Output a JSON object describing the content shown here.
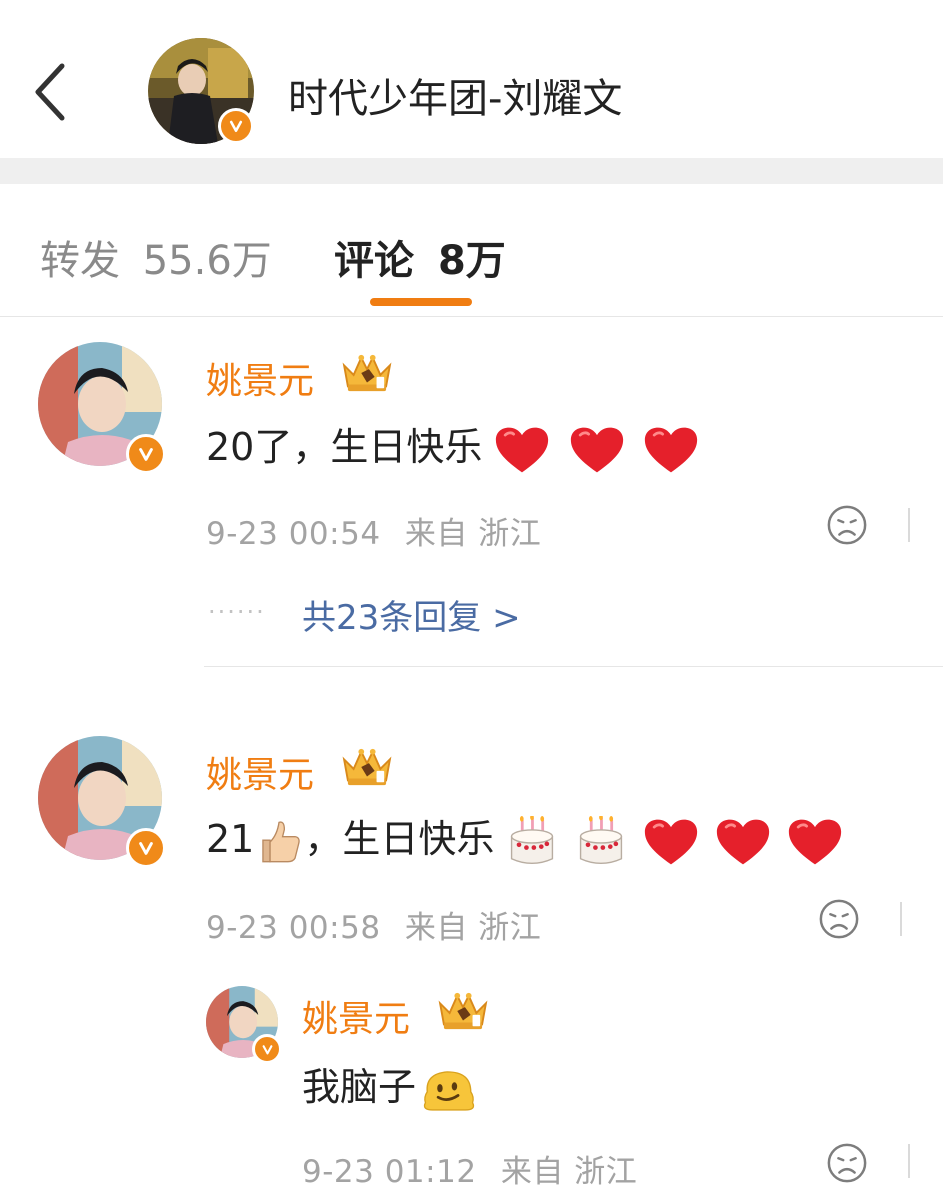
{
  "header": {
    "title": "时代少年团-刘耀文",
    "back_icon": "chevron-left-icon",
    "verified_icon": "verified-v-icon"
  },
  "tabs": [
    {
      "label": "转发",
      "count": "55.6万",
      "active": false
    },
    {
      "label": "评论",
      "count": "8万",
      "active": true
    }
  ],
  "colors": {
    "accent": "#f07d12",
    "link": "#4a6ba3",
    "meta": "#a3a3a3",
    "badge": "#f08a19"
  },
  "comments": [
    {
      "username": "姚景元",
      "badge_icon": "crown-badge-icon",
      "text": "20了，生日快乐",
      "emojis": [
        "heart-icon",
        "heart-icon",
        "heart-icon"
      ],
      "time": "9-23 00:54",
      "source": "来自 浙江",
      "reply_dots": "······",
      "reply_link": "共23条回复 >"
    },
    {
      "username": "姚景元",
      "badge_icon": "crown-badge-icon",
      "text_prefix": "21",
      "text": "，生日快乐",
      "emojis": [
        "thumbs-up-icon",
        "cake-icon",
        "cake-icon",
        "heart-icon",
        "heart-icon",
        "heart-icon"
      ],
      "time": "9-23 00:58",
      "source": "来自 浙江"
    }
  ],
  "replies": [
    {
      "username": "姚景元",
      "badge_icon": "crown-badge-icon",
      "text": "我脑子",
      "emojis": [
        "melting-face-icon"
      ],
      "time": "9-23 01:12",
      "source": "来自 浙江"
    }
  ]
}
